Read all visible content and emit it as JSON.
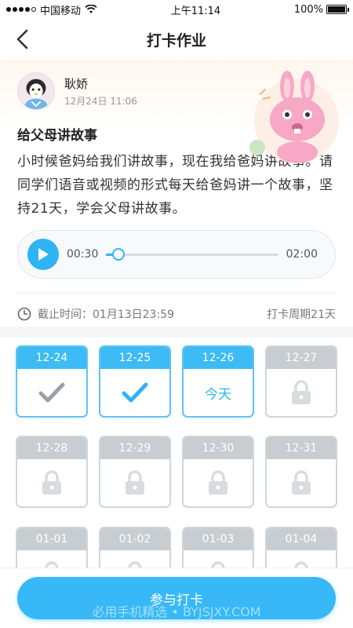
{
  "status": {
    "carrier": "中国移动",
    "time": "上午11:14",
    "battery": "100%"
  },
  "nav": {
    "title": "打卡作业"
  },
  "author": {
    "name": "耿娇",
    "date": "12月24日 11:06"
  },
  "task": {
    "title": "给父母讲故事",
    "description": "小时候爸妈给我们讲故事，现在我给爸妈讲故事。请同学们语音或视频的形式每天给爸妈讲一个故事，坚持21天，学会父母讲故事。"
  },
  "audio": {
    "current": "00:30",
    "total": "02:00",
    "progress": 0.07
  },
  "meta": {
    "deadline": "截止时间：01月13日23:59",
    "period": "打卡周期21天"
  },
  "calendar": {
    "days": [
      {
        "date": "12-24",
        "state": "done-gray"
      },
      {
        "date": "12-25",
        "state": "done-blue"
      },
      {
        "date": "12-26",
        "state": "today",
        "label": "今天"
      },
      {
        "date": "12-27",
        "state": "locked"
      },
      {
        "date": "12-28",
        "state": "locked"
      },
      {
        "date": "12-29",
        "state": "locked"
      },
      {
        "date": "12-30",
        "state": "locked"
      },
      {
        "date": "12-31",
        "state": "locked"
      },
      {
        "date": "01-01",
        "state": "locked"
      },
      {
        "date": "01-02",
        "state": "locked"
      },
      {
        "date": "01-03",
        "state": "locked"
      },
      {
        "date": "01-04",
        "state": "locked"
      }
    ]
  },
  "footer": {
    "button": "参与打卡",
    "watermark": "必用手机精选 • BYJSJXY.COM"
  },
  "colors": {
    "accent": "#2eb4f4",
    "locked_gray": "#c8cdd1"
  }
}
